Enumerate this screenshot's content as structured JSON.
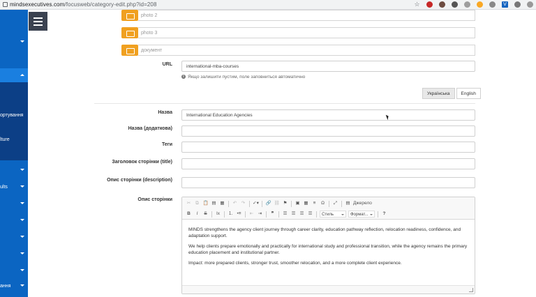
{
  "browser": {
    "url_host": "mindsexecutives.com",
    "url_path": "/focusweb/category-edit.php?id=208"
  },
  "sidebar": {
    "items": [
      {
        "label": "ортування"
      },
      {
        "label": "lture"
      },
      {
        "label": "ults"
      },
      {
        "label": "ання"
      }
    ]
  },
  "form": {
    "photo2_placeholder": "photo 2",
    "photo3_placeholder": "photo 3",
    "document_placeholder": "документ",
    "url_label": "URL",
    "url_value": "international-mba-courses",
    "url_hint": "Якщо залишити пустим, поле заповниться автоматично",
    "lang_tabs": [
      "Українська",
      "English"
    ],
    "name_label": "Назва",
    "name_value": "International Education Agencies",
    "name_extra_label": "Назва (додаткова)",
    "tags_label": "Теги",
    "page_title_label": "Заголовок сторінки (title)",
    "page_desc_label": "Опис сторінки (description)",
    "desc_label": "Опис сторінки"
  },
  "editor": {
    "toolbar": {
      "source_label": "Джерело",
      "style_label": "Стиль",
      "format_label": "Формат..."
    },
    "paragraphs": [
      "MINDS strengthens the agency client journey through career clarity, education pathway reflection, relocation readiness, confidence, and adaptation support.",
      "We help clients prepare emotionally and practically for international study and professional transition, while the agency remains the primary education placement and institutional partner.",
      "Impact: more prepared clients, stronger trust, smoother relocation, and a more complete client experience."
    ]
  },
  "colors": {
    "sidebar": "#0b65c2",
    "folder": "#f0a020"
  }
}
